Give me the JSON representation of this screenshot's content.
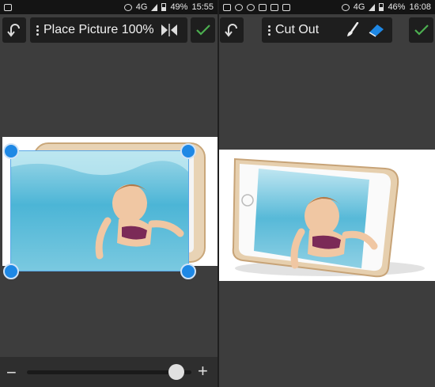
{
  "left": {
    "status": {
      "network": "4G",
      "battery": "49%",
      "time": "15:55"
    },
    "toolbar": {
      "title": "Place Picture 100%"
    },
    "slider": {
      "minus": "−",
      "plus": "+",
      "value": 0.91
    }
  },
  "right": {
    "status": {
      "network": "4G",
      "battery": "46%",
      "time": "16:08"
    },
    "toolbar": {
      "title": "Cut Out"
    }
  },
  "colors": {
    "accent": "#1e88e5",
    "check": "#4caf50",
    "eraser": "#1e88e5"
  },
  "icons": [
    "undo-icon",
    "flip-horizontal-icon",
    "checkmark-icon",
    "brush-icon",
    "eraser-icon",
    "menu-dots-icon"
  ]
}
